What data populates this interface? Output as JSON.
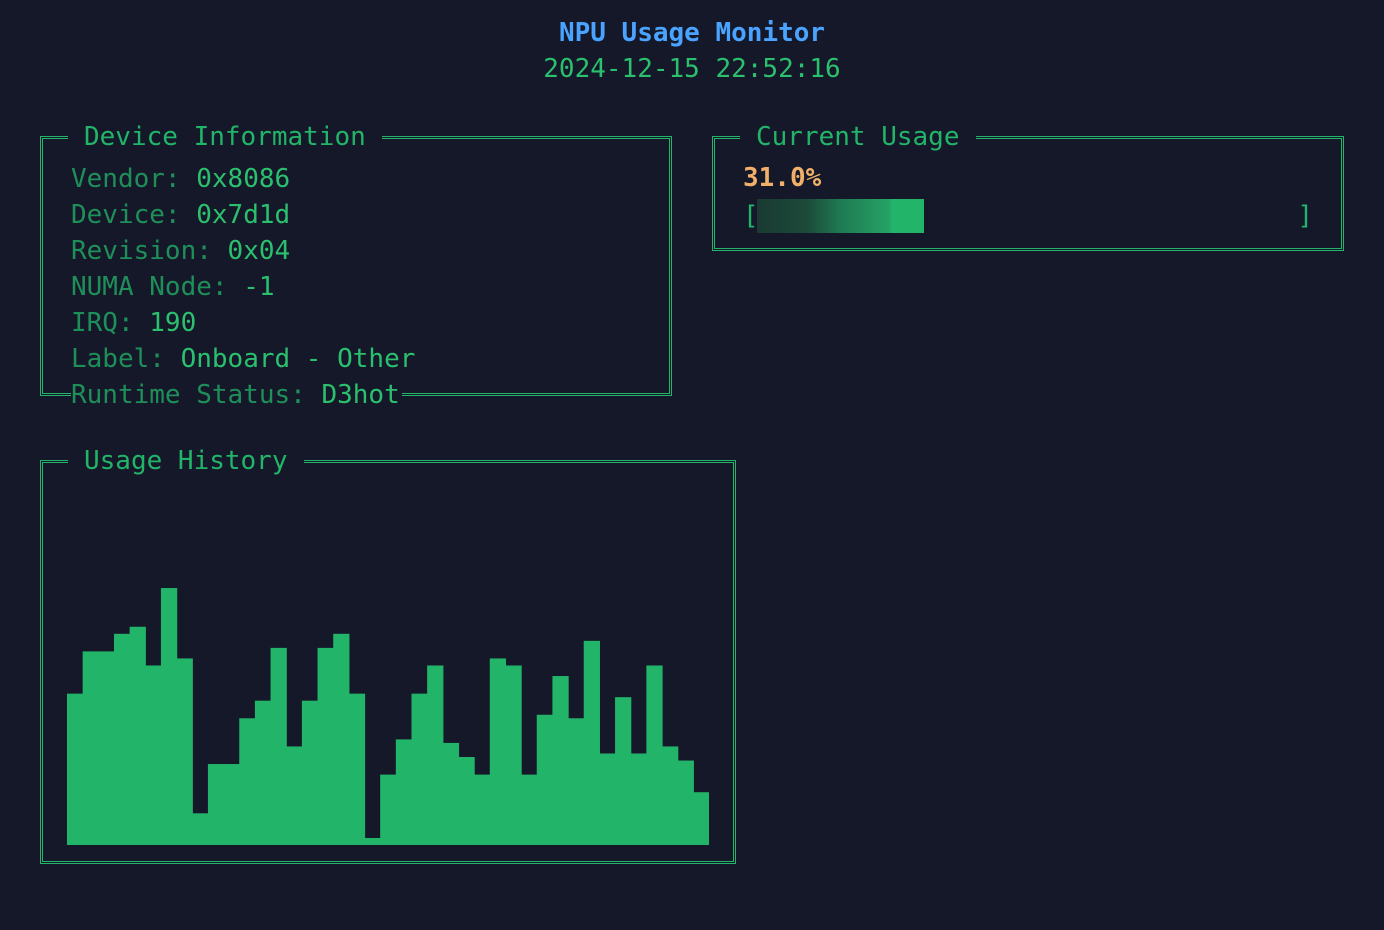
{
  "header": {
    "title": "NPU Usage Monitor",
    "timestamp": "2024-12-15 22:52:16"
  },
  "device_info": {
    "title": "Device Information",
    "rows": [
      {
        "key": "Vendor: ",
        "value": "0x8086"
      },
      {
        "key": "Device: ",
        "value": "0x7d1d"
      },
      {
        "key": "Revision: ",
        "value": "0x04"
      },
      {
        "key": "NUMA Node: ",
        "value": "-1"
      },
      {
        "key": "IRQ: ",
        "value": "190"
      },
      {
        "key": "Label: ",
        "value": "Onboard - Other"
      },
      {
        "key": "Runtime Status: ",
        "value": "D3hot"
      }
    ]
  },
  "current_usage": {
    "title": "Current Usage",
    "percent_label": "31.0%",
    "percent_value": 31.0,
    "bar_left": "[",
    "bar_right": "]"
  },
  "usage_history": {
    "title": "Usage History"
  },
  "chart_data": {
    "type": "bar",
    "title": "",
    "xlabel": "",
    "ylabel": "",
    "ylim": [
      0,
      100
    ],
    "grid": false,
    "values": [
      43,
      55,
      55,
      60,
      62,
      51,
      73,
      53,
      9,
      23,
      23,
      36,
      41,
      56,
      28,
      41,
      56,
      60,
      43,
      2,
      20,
      30,
      43,
      51,
      29,
      25,
      20,
      53,
      51,
      20,
      37,
      48,
      36,
      58,
      26,
      42,
      26,
      51,
      28,
      24,
      15
    ],
    "color": "#22b468"
  },
  "colors": {
    "background": "#141829",
    "accent": "#22b468",
    "title_blue": "#4aa3ff",
    "percent_orange": "#f0b06a"
  }
}
